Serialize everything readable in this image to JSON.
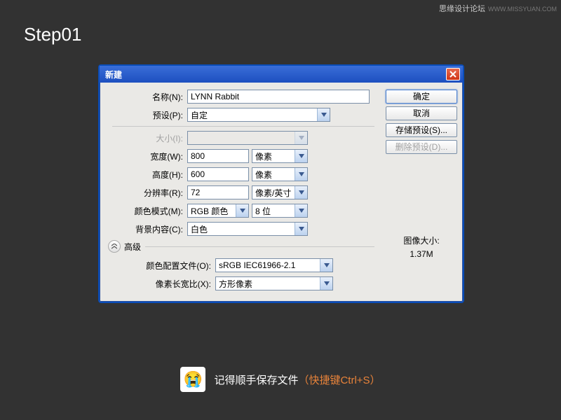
{
  "watermark": {
    "cn": "思缘设计论坛",
    "en": "WWW.MISSYUAN.COM"
  },
  "step": "Step01",
  "dialog": {
    "title": "新建",
    "labels": {
      "name": "名称(N):",
      "preset": "预设(P):",
      "size": "大小(I):",
      "width": "宽度(W):",
      "height": "高度(H):",
      "resolution": "分辨率(R):",
      "colorMode": "颜色模式(M):",
      "bgContent": "背景内容(C):",
      "advanced": "高级",
      "colorProfile": "颜色配置文件(O):",
      "pixelAspect": "像素长宽比(X):"
    },
    "values": {
      "name": "LYNN Rabbit",
      "preset": "自定",
      "size": "",
      "width": "800",
      "widthUnit": "像素",
      "height": "600",
      "heightUnit": "像素",
      "resolution": "72",
      "resolutionUnit": "像素/英寸",
      "colorMode": "RGB 颜色",
      "colorBits": "8 位",
      "bgContent": "白色",
      "colorProfile": "sRGB IEC61966-2.1",
      "pixelAspect": "方形像素"
    },
    "buttons": {
      "ok": "确定",
      "cancel": "取消",
      "savePreset": "存储预设(S)...",
      "deletePreset": "删除预设(D)..."
    },
    "imageSize": {
      "label": "图像大小:",
      "value": "1.37M"
    }
  },
  "footer": {
    "text1": "记得顺手保存文件",
    "text2": "（快捷键Ctrl+S）"
  }
}
